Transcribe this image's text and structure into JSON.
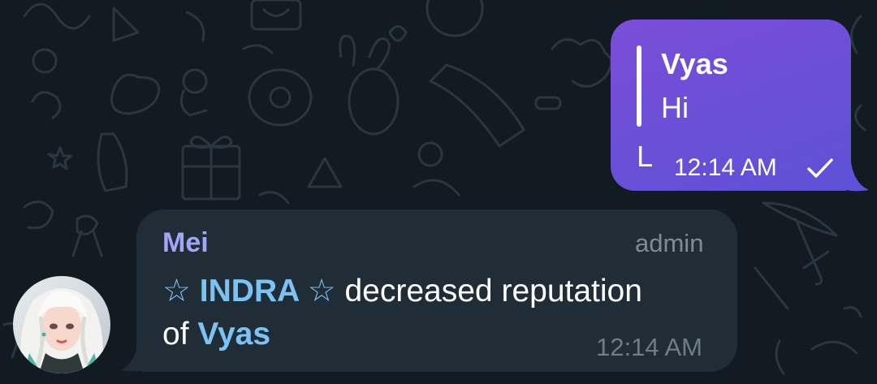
{
  "colors": {
    "background": "#111b21",
    "outgoing_bubble": "#6a4fd8",
    "incoming_bubble": "#212d36",
    "sender_name": "#a3a5f5",
    "mention": "#7cc3f5",
    "meta_text": "#7f8c95"
  },
  "outgoing_message": {
    "reply_to": {
      "name": "Vyas",
      "text": "Hi"
    },
    "text": "L",
    "time": "12:14 AM",
    "status_icon": "single-check-icon"
  },
  "incoming_message": {
    "sender": "Mei",
    "role": "admin",
    "mention_1": "☆ INDRA ☆",
    "text_part_1": " decreased reputation",
    "text_part_2": "of ",
    "mention_2": "Vyas",
    "time": "12:14 AM",
    "avatar_icon": "user-avatar"
  }
}
